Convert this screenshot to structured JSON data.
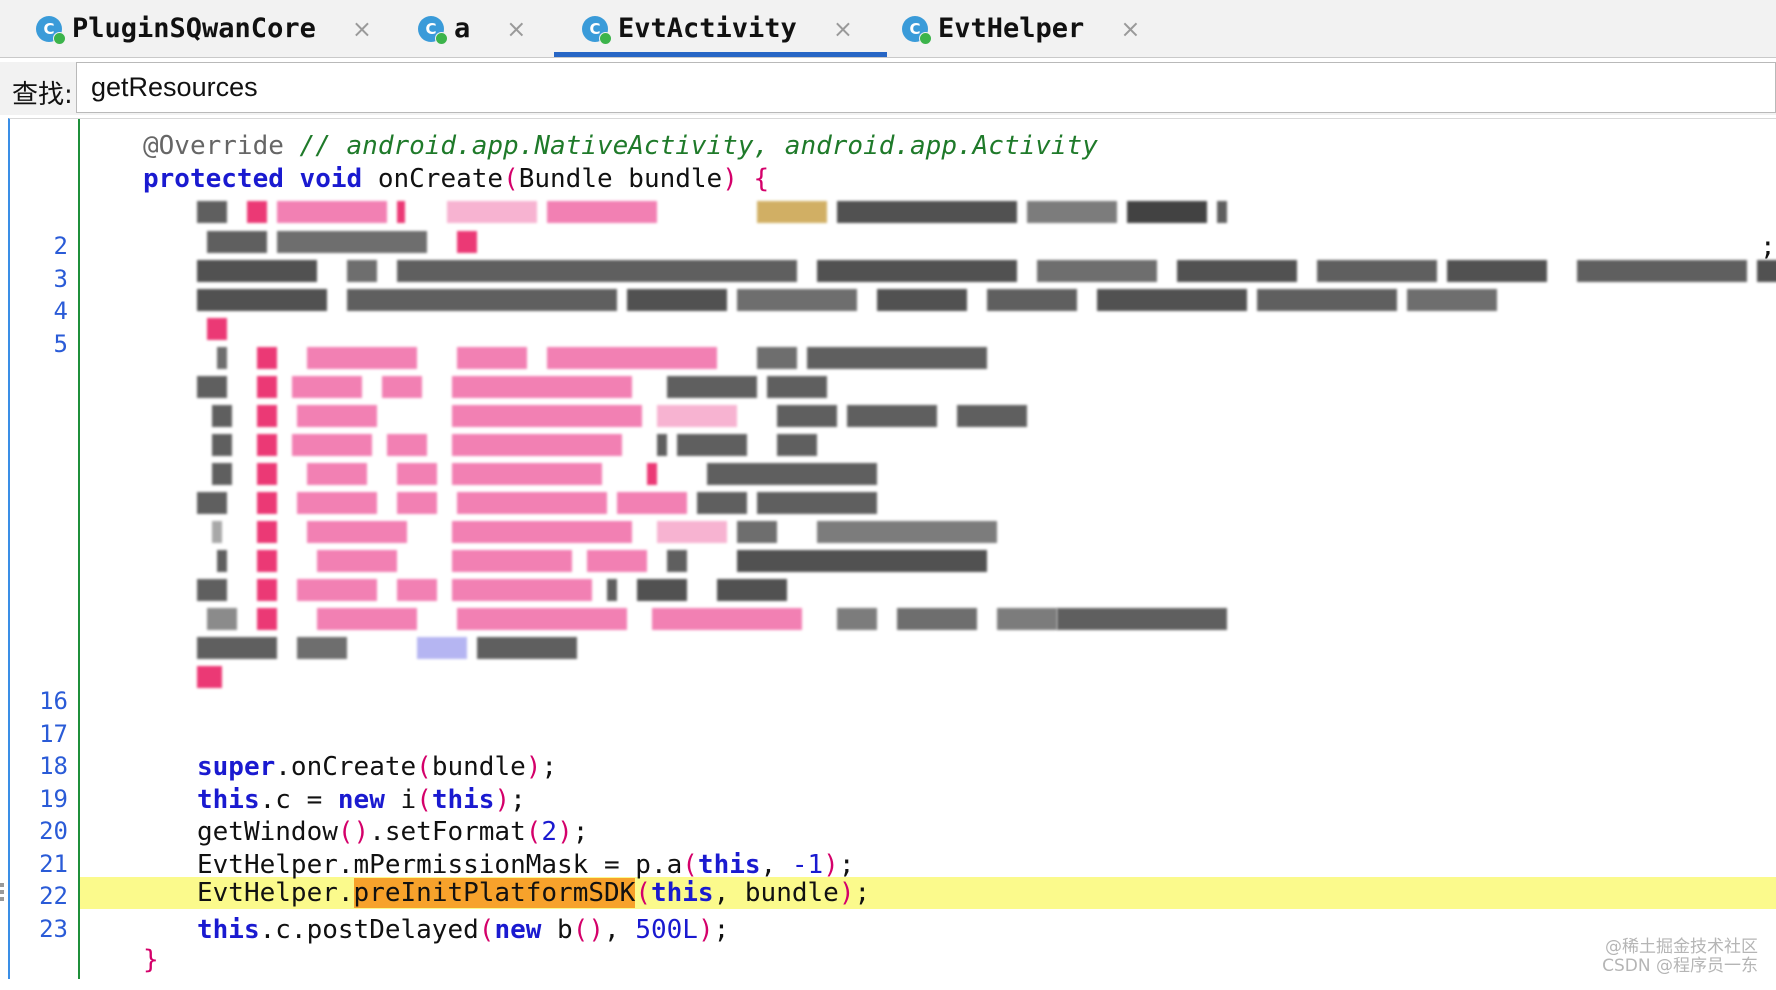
{
  "tabs": [
    {
      "icon": "C",
      "label": "PluginSQwanCore",
      "active": false
    },
    {
      "icon": "C",
      "label": "a",
      "active": false
    },
    {
      "icon": "C",
      "label": "EvtActivity",
      "active": true
    },
    {
      "icon": "C",
      "label": "EvtHelper",
      "active": false
    }
  ],
  "tab_close_glyph": "×",
  "search": {
    "label": "查找:",
    "value": "getResources"
  },
  "line_numbers": [
    "2",
    "3",
    "4",
    "5",
    "16",
    "17",
    "18",
    "19",
    "20",
    "21",
    "22",
    "23"
  ],
  "code": {
    "override_annotation": "@Override",
    "override_comment": "// android.app.NativeActivity, android.app.Activity",
    "sig_kw1": "protected",
    "sig_kw2": "void",
    "sig_name": "onCreate",
    "sig_params": "Bundle bundle",
    "open_brace": "{",
    "close_brace": "}",
    "obscured_line_end": ";",
    "l18_kw": "super",
    "l18_rest": ".onCreate",
    "l18_arg": "bundle",
    "l19_kw": "this",
    "l19_mid": ".c = ",
    "l19_new": "new",
    "l19_cls": " i",
    "l19_arg": "this",
    "l20_a": "getWindow",
    "l20_b": ".setFormat",
    "l20_num": "2",
    "l21_a": "EvtHelper.mPermissionMask = p.a",
    "l21_this": "this",
    "l21_num": "-1",
    "l22_a": "EvtHelper.",
    "l22_match": "preInitPlatformSDK",
    "l22_this": "this",
    "l22_arg": "bundle",
    "l23_this": "this",
    "l23_mid": ".c.postDelayed",
    "l23_new": "new",
    "l23_cls": " b",
    "l23_num": "500L"
  },
  "highlight_color": "#fbfa8c",
  "match_color": "#f7a22b",
  "watermark": {
    "line1": "@稀土掘金技术社区",
    "line2": "CSDN @程序员一东"
  }
}
